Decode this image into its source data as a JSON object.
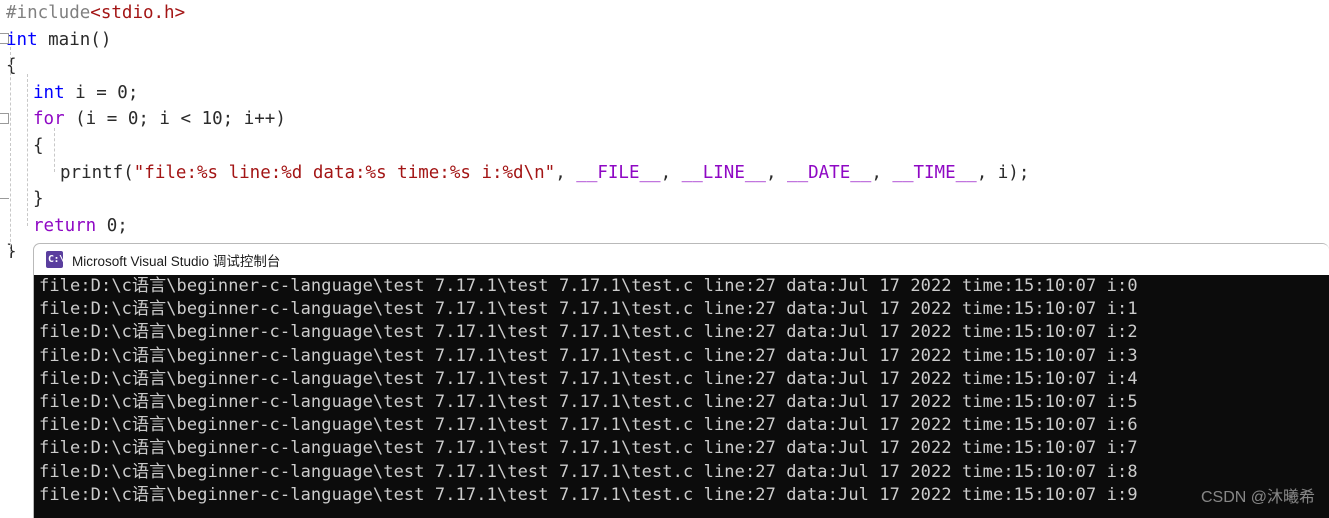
{
  "editor": {
    "name": "visual-studio-code-editor",
    "lines": [
      {
        "id": "l1",
        "indent": 0,
        "tokens": [
          {
            "t": "#include",
            "c": "pre"
          },
          {
            "t": "<stdio.h>",
            "c": "inc"
          }
        ]
      },
      {
        "id": "l2",
        "indent": 0,
        "tokens": [
          {
            "t": "int",
            "c": "kw"
          },
          {
            "t": " main()",
            "c": "plain"
          }
        ]
      },
      {
        "id": "l3",
        "indent": 0,
        "tokens": [
          {
            "t": "{",
            "c": "brace"
          }
        ]
      },
      {
        "id": "l4",
        "indent": 1,
        "tokens": [
          {
            "t": "int",
            "c": "kw"
          },
          {
            "t": " i = 0;",
            "c": "plain"
          }
        ]
      },
      {
        "id": "l5",
        "indent": 1,
        "tokens": [
          {
            "t": "for",
            "c": "ctl"
          },
          {
            "t": " (i = 0; i < 10; i++)",
            "c": "plain"
          }
        ]
      },
      {
        "id": "l6",
        "indent": 1,
        "tokens": [
          {
            "t": "{",
            "c": "brace"
          }
        ]
      },
      {
        "id": "l7",
        "indent": 2,
        "tokens": [
          {
            "t": "printf(",
            "c": "plain"
          },
          {
            "t": "\"file:%s line:%d data:%s time:%s i:%d\\n\"",
            "c": "str"
          },
          {
            "t": ", ",
            "c": "plain"
          },
          {
            "t": "__FILE__",
            "c": "macro"
          },
          {
            "t": ", ",
            "c": "plain"
          },
          {
            "t": "__LINE__",
            "c": "macro"
          },
          {
            "t": ", ",
            "c": "plain"
          },
          {
            "t": "__DATE__",
            "c": "macro"
          },
          {
            "t": ", ",
            "c": "plain"
          },
          {
            "t": "__TIME__",
            "c": "macro"
          },
          {
            "t": ", i);",
            "c": "plain"
          }
        ]
      },
      {
        "id": "l8",
        "indent": 1,
        "tokens": [
          {
            "t": "}",
            "c": "brace"
          }
        ]
      },
      {
        "id": "l9",
        "indent": 1,
        "tokens": [
          {
            "t": "return",
            "c": "ctl"
          },
          {
            "t": " 0;",
            "c": "plain"
          }
        ]
      },
      {
        "id": "l10",
        "indent": 0,
        "tokens": [
          {
            "t": "}",
            "c": "brace"
          }
        ]
      }
    ]
  },
  "console": {
    "window_title": "Microsoft Visual Studio 调试控制台",
    "icon": "cmd-console-icon",
    "icon_glyph": "C:\\",
    "background_color": "#0c0c0c",
    "text_color": "#cccccc",
    "output_lines": [
      "file:D:\\c语言\\beginner-c-language\\test 7.17.1\\test 7.17.1\\test.c line:27 data:Jul 17 2022 time:15:10:07 i:0",
      "file:D:\\c语言\\beginner-c-language\\test 7.17.1\\test 7.17.1\\test.c line:27 data:Jul 17 2022 time:15:10:07 i:1",
      "file:D:\\c语言\\beginner-c-language\\test 7.17.1\\test 7.17.1\\test.c line:27 data:Jul 17 2022 time:15:10:07 i:2",
      "file:D:\\c语言\\beginner-c-language\\test 7.17.1\\test 7.17.1\\test.c line:27 data:Jul 17 2022 time:15:10:07 i:3",
      "file:D:\\c语言\\beginner-c-language\\test 7.17.1\\test 7.17.1\\test.c line:27 data:Jul 17 2022 time:15:10:07 i:4",
      "file:D:\\c语言\\beginner-c-language\\test 7.17.1\\test 7.17.1\\test.c line:27 data:Jul 17 2022 time:15:10:07 i:5",
      "file:D:\\c语言\\beginner-c-language\\test 7.17.1\\test 7.17.1\\test.c line:27 data:Jul 17 2022 time:15:10:07 i:6",
      "file:D:\\c语言\\beginner-c-language\\test 7.17.1\\test 7.17.1\\test.c line:27 data:Jul 17 2022 time:15:10:07 i:7",
      "file:D:\\c语言\\beginner-c-language\\test 7.17.1\\test 7.17.1\\test.c line:27 data:Jul 17 2022 time:15:10:07 i:8",
      "file:D:\\c语言\\beginner-c-language\\test 7.17.1\\test 7.17.1\\test.c line:27 data:Jul 17 2022 time:15:10:07 i:9"
    ]
  },
  "watermark": {
    "text": "CSDN @沐曦希"
  },
  "colors": {
    "preprocessor": "#808080",
    "include_path": "#a31515",
    "keyword": "#0000ff",
    "control_keyword": "#8f08c4",
    "string": "#a31515",
    "macro": "#8f08c4",
    "plain": "#2b2b2b",
    "console_bg": "#0c0c0c",
    "console_fg": "#cccccc",
    "icon_purple": "#5a3e9e"
  }
}
